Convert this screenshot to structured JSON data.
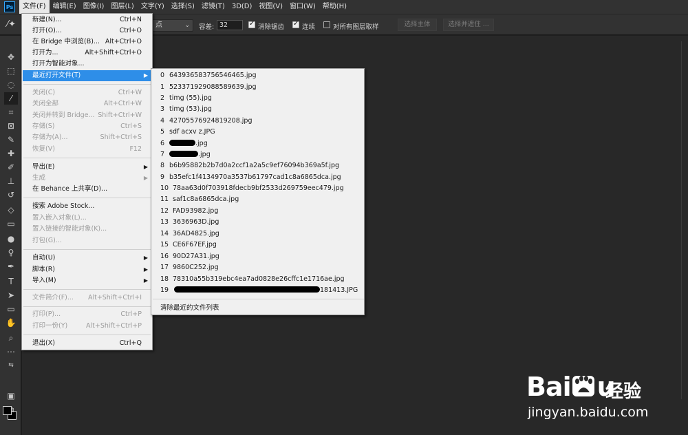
{
  "menubar": {
    "logo": "Ps",
    "items": [
      "文件(F)",
      "编辑(E)",
      "图像(I)",
      "图层(L)",
      "文字(Y)",
      "选择(S)",
      "滤镜(T)",
      "3D(D)",
      "视图(V)",
      "窗口(W)",
      "帮助(H)"
    ]
  },
  "options": {
    "sample_value": "点",
    "tolerance_label": "容差:",
    "tolerance_value": "32",
    "antialias_label": "消除锯齿",
    "contiguous_label": "连续",
    "all_layers_label": "对所有图层取样",
    "select_subject": "选择主体",
    "select_and_mask": "选择并遮住 ..."
  },
  "file_menu": {
    "items": [
      {
        "label": "新建(N)...",
        "shortcut": "Ctrl+N"
      },
      {
        "label": "打开(O)...",
        "shortcut": "Ctrl+O"
      },
      {
        "label": "在 Bridge 中浏览(B)...",
        "shortcut": "Alt+Ctrl+O"
      },
      {
        "label": "打开为...",
        "shortcut": "Alt+Shift+Ctrl+O"
      },
      {
        "label": "打开为智能对象...",
        "shortcut": ""
      },
      {
        "label": "最近打开文件(T)",
        "shortcut": ""
      },
      {
        "label": "关闭(C)",
        "shortcut": "Ctrl+W"
      },
      {
        "label": "关闭全部",
        "shortcut": "Alt+Ctrl+W"
      },
      {
        "label": "关闭并转到 Bridge...",
        "shortcut": "Shift+Ctrl+W"
      },
      {
        "label": "存储(S)",
        "shortcut": "Ctrl+S"
      },
      {
        "label": "存储为(A)...",
        "shortcut": "Shift+Ctrl+S"
      },
      {
        "label": "恢复(V)",
        "shortcut": "F12"
      },
      {
        "label": "导出(E)",
        "shortcut": ""
      },
      {
        "label": "生成",
        "shortcut": ""
      },
      {
        "label": "在 Behance 上共享(D)...",
        "shortcut": ""
      },
      {
        "label": "搜索 Adobe Stock...",
        "shortcut": ""
      },
      {
        "label": "置入嵌入对象(L)...",
        "shortcut": ""
      },
      {
        "label": "置入链接的智能对象(K)...",
        "shortcut": ""
      },
      {
        "label": "打包(G)...",
        "shortcut": ""
      },
      {
        "label": "自动(U)",
        "shortcut": ""
      },
      {
        "label": "脚本(R)",
        "shortcut": ""
      },
      {
        "label": "导入(M)",
        "shortcut": ""
      },
      {
        "label": "文件简介(F)...",
        "shortcut": "Alt+Shift+Ctrl+I"
      },
      {
        "label": "打印(P)...",
        "shortcut": "Ctrl+P"
      },
      {
        "label": "打印一份(Y)",
        "shortcut": "Alt+Shift+Ctrl+P"
      },
      {
        "label": "退出(X)",
        "shortcut": "Ctrl+Q"
      }
    ]
  },
  "recent_files": {
    "items": [
      {
        "num": "0",
        "name": "643936583756546465.jpg"
      },
      {
        "num": "1",
        "name": "523371929088589639.jpg"
      },
      {
        "num": "2",
        "name": "timg (55).jpg"
      },
      {
        "num": "3",
        "name": "timg (53).jpg"
      },
      {
        "num": "4",
        "name": "42705576924819208.jpg"
      },
      {
        "num": "5",
        "name": "sdf acxv z.JPG"
      },
      {
        "num": "6",
        "name": ".jpg"
      },
      {
        "num": "7",
        "name": ".jpg"
      },
      {
        "num": "8",
        "name": "b6b95882b2b7d0a2ccf1a2a5c9ef76094b369a5f.jpg"
      },
      {
        "num": "9",
        "name": "b35efc1f4134970a3537b61797cad1c8a6865dca.jpg"
      },
      {
        "num": "10",
        "name": "78aa63d0f703918fdecb9bf2533d269759eec479.jpg"
      },
      {
        "num": "11",
        "name": "saf1c8a6865dca.jpg"
      },
      {
        "num": "12",
        "name": "FAD93982.jpg"
      },
      {
        "num": "13",
        "name": "3636963D.jpg"
      },
      {
        "num": "14",
        "name": "36AD4825.jpg"
      },
      {
        "num": "15",
        "name": "CE6F67EF.jpg"
      },
      {
        "num": "16",
        "name": "90D27A31.jpg"
      },
      {
        "num": "17",
        "name": "9860C252.jpg"
      },
      {
        "num": "18",
        "name": "78310a55b319ebc4ea7ad0828e26cffc1e1716ae.jpg"
      },
      {
        "num": "19",
        "name": "181413.JPG"
      }
    ],
    "clear_label": "清除最近的文件列表"
  },
  "watermark": {
    "brand_latin_1": "Bai",
    "brand_latin_2": "u",
    "brand_cn": "经验",
    "url": "jingyan.baidu.com"
  }
}
